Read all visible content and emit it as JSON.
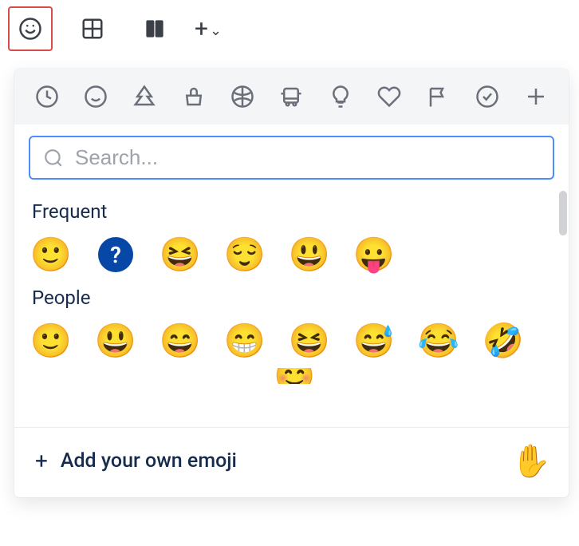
{
  "toolbar": {
    "items": [
      {
        "name": "emoji-smile-icon"
      },
      {
        "name": "table-icon"
      },
      {
        "name": "layouts-icon"
      },
      {
        "name": "insert-more-icon"
      }
    ]
  },
  "categories": [
    {
      "name": "recent-icon"
    },
    {
      "name": "people-icon"
    },
    {
      "name": "nature-icon"
    },
    {
      "name": "food-icon"
    },
    {
      "name": "activity-icon"
    },
    {
      "name": "travel-icon"
    },
    {
      "name": "objects-icon"
    },
    {
      "name": "symbols-icon"
    },
    {
      "name": "flags-icon"
    },
    {
      "name": "productivity-icon"
    },
    {
      "name": "custom-add-icon"
    }
  ],
  "search": {
    "placeholder": "Search...",
    "value": ""
  },
  "sections": {
    "frequent": {
      "title": "Frequent",
      "items": [
        "🙂",
        "?",
        "😆",
        "😌",
        "😃",
        "😛"
      ]
    },
    "people": {
      "title": "People",
      "items": [
        "🙂",
        "😃",
        "😄",
        "😁",
        "😆",
        "😅",
        "😂",
        "🤣"
      ],
      "second_row_partial": [
        "😊"
      ]
    }
  },
  "footer": {
    "add_label": "Add your own emoji",
    "preview_emoji": "✋"
  }
}
